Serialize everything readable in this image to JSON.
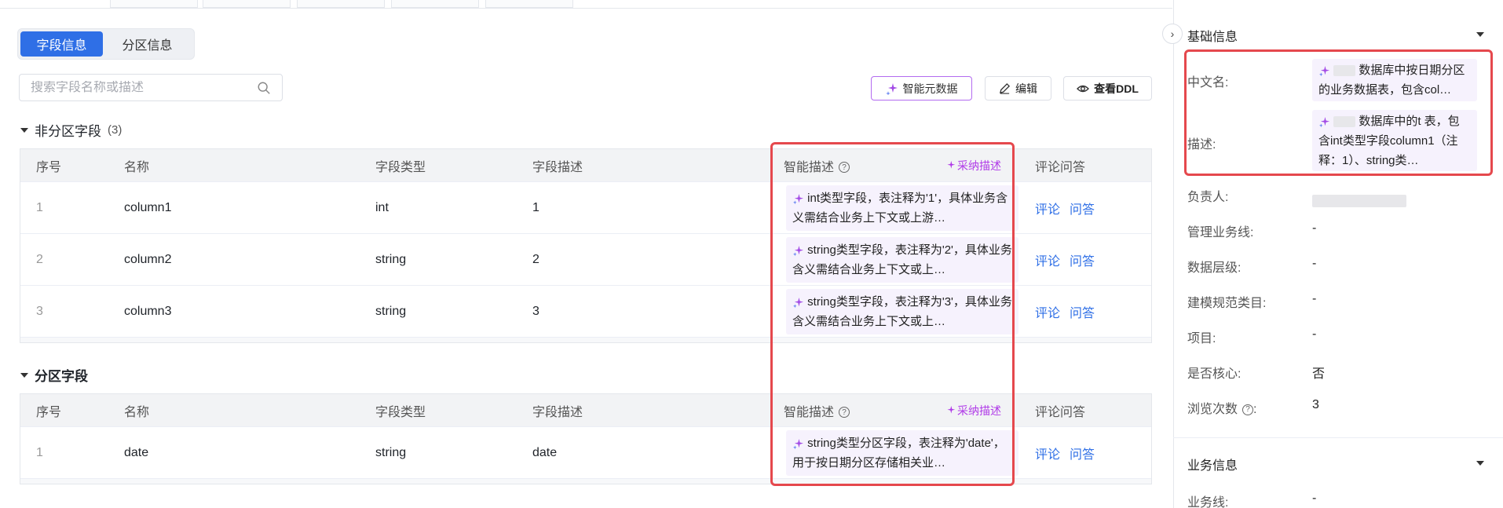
{
  "tabs": {
    "field_info": "字段信息",
    "partition_info": "分区信息"
  },
  "search": {
    "placeholder": "搜索字段名称或描述"
  },
  "toolbar": {
    "ai_metadata": "智能元数据",
    "edit": "编辑",
    "view_ddl": "查看DDL"
  },
  "non_partition": {
    "title": "非分区字段",
    "count": "(3)",
    "headers": {
      "idx": "序号",
      "name": "名称",
      "type": "字段类型",
      "desc": "字段描述",
      "ai": "智能描述",
      "adopt": "采纳描述",
      "ops": "评论问答"
    },
    "rows": [
      {
        "idx": "1",
        "name": "column1",
        "type": "int",
        "desc": "1",
        "ai": "int类型字段，表注释为'1'，具体业务含义需结合业务上下文或上游…"
      },
      {
        "idx": "2",
        "name": "column2",
        "type": "string",
        "desc": "2",
        "ai": "string类型字段，表注释为'2'，具体业务含义需结合业务上下文或上…"
      },
      {
        "idx": "3",
        "name": "column3",
        "type": "string",
        "desc": "3",
        "ai": "string类型字段，表注释为'3'，具体业务含义需结合业务上下文或上…"
      }
    ],
    "comment": "评论",
    "qa": "问答"
  },
  "partition": {
    "title": "分区字段",
    "headers": {
      "idx": "序号",
      "name": "名称",
      "type": "字段类型",
      "desc": "字段描述",
      "ai": "智能描述",
      "adopt": "采纳描述",
      "ops": "评论问答"
    },
    "rows": [
      {
        "idx": "1",
        "name": "date",
        "type": "string",
        "desc": "date",
        "ai": "string类型分区字段，表注释为'date'，用于按日期分区存储相关业…"
      }
    ],
    "comment": "评论",
    "qa": "问答"
  },
  "side": {
    "basic_title": "基础信息",
    "cn_name_label": "中文名:",
    "cn_name_value": "数据库中按日期分区的业务数据表，包含col…",
    "desc_label": "描述:",
    "desc_value": "数据库中的t 表，包含int类型字段column1（注释：1）、string类…",
    "owner_label": "负责人:",
    "biz_line_label": "管理业务线:",
    "biz_line_value": "-",
    "layer_label": "数据层级:",
    "layer_value": "-",
    "model_label": "建模规范类目:",
    "model_value": "-",
    "project_label": "项目:",
    "project_value": "-",
    "core_label": "是否核心:",
    "core_value": "否",
    "views_label": "浏览次数",
    "views_value": "3",
    "business_title": "业务信息",
    "business_line_label": "业务线:",
    "business_line_value": "-"
  },
  "colors": {
    "accent": "#2f6fe6",
    "ai_purple": "#b03ae8",
    "highlight_red": "#e5484d"
  }
}
